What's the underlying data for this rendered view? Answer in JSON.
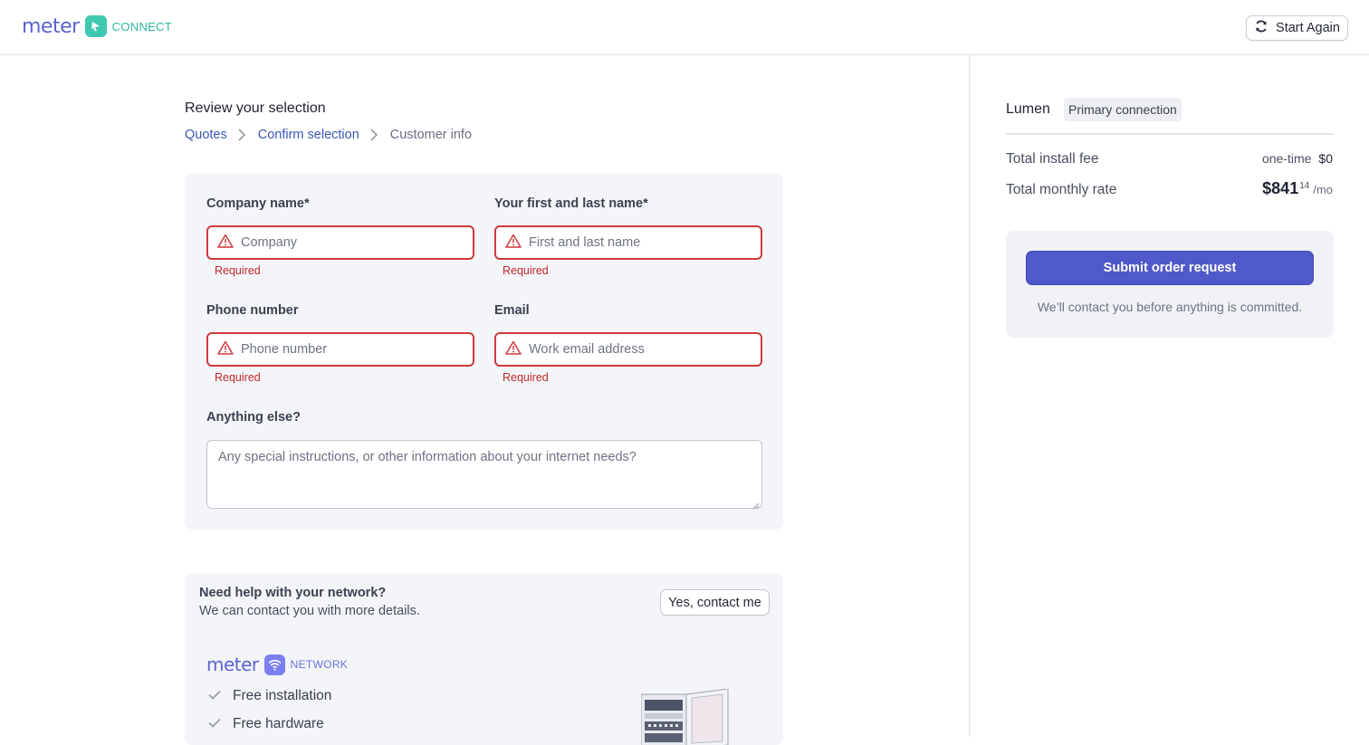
{
  "header": {
    "logo_word": "meter",
    "logo_product": "CONNECT",
    "start_again_label": "Start Again"
  },
  "main": {
    "title": "Review your selection",
    "breadcrumb": [
      {
        "label": "Quotes"
      },
      {
        "label": "Confirm selection"
      },
      {
        "label": "Customer info"
      }
    ],
    "form": {
      "company": {
        "label": "Company name*",
        "placeholder": "Company",
        "error": "Required"
      },
      "name": {
        "label": "Your first and last name*",
        "placeholder": "First and last name",
        "error": "Required"
      },
      "phone": {
        "label": "Phone number",
        "placeholder": "Phone number",
        "error": "Required"
      },
      "email": {
        "label": "Email",
        "placeholder": "Work email address",
        "error": "Required"
      },
      "notes": {
        "label": "Anything else?",
        "placeholder": "Any special instructions, or other information about your internet needs?"
      }
    },
    "help": {
      "title": "Need help with your network?",
      "subtitle": "We can contact you with more details.",
      "contact_label": "Yes, contact me",
      "logo_word": "meter",
      "logo_product": "NETWORK",
      "features": [
        "Free installation",
        "Free hardware"
      ]
    }
  },
  "summary": {
    "provider": "Lumen",
    "connection_badge": "Primary connection",
    "install_fee_label": "Total install fee",
    "install_fee_qualifier": "one-time",
    "install_fee_value": "$0",
    "monthly_label": "Total monthly rate",
    "monthly_dollars": "$841",
    "monthly_cents": "14",
    "monthly_unit": "/mo",
    "submit_label": "Submit order request",
    "submit_note": "We’ll contact you before anything is committed."
  },
  "colors": {
    "accent": "#5059c9",
    "link": "#3c56b6",
    "error": "#d0393e",
    "connect_brand": "#3fc8b0",
    "network_brand": "#7c7ff0"
  }
}
